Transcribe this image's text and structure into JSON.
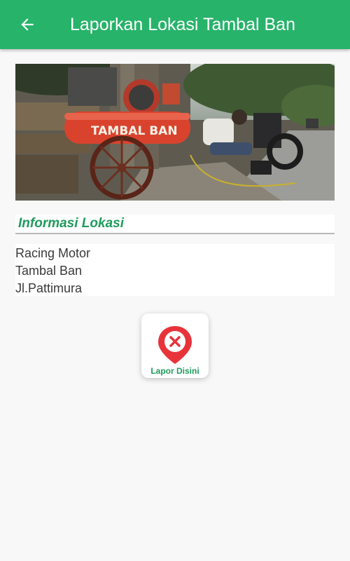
{
  "appbar": {
    "title": "Laporkan Lokasi Tambal Ban",
    "back_icon": "arrow-left-icon"
  },
  "photo": {
    "sign_text": "TAMBAL BAN"
  },
  "section": {
    "title": "Informasi Lokasi"
  },
  "location": {
    "name": "Racing Motor",
    "category": "Tambal Ban",
    "address": "Jl.Pattimura"
  },
  "report_button": {
    "label": "Lapor Disini",
    "icon": "map-pin-x-icon"
  },
  "colors": {
    "primary": "#27b36a",
    "accent_text": "#1d9b5c",
    "pin_red": "#e8333b"
  }
}
